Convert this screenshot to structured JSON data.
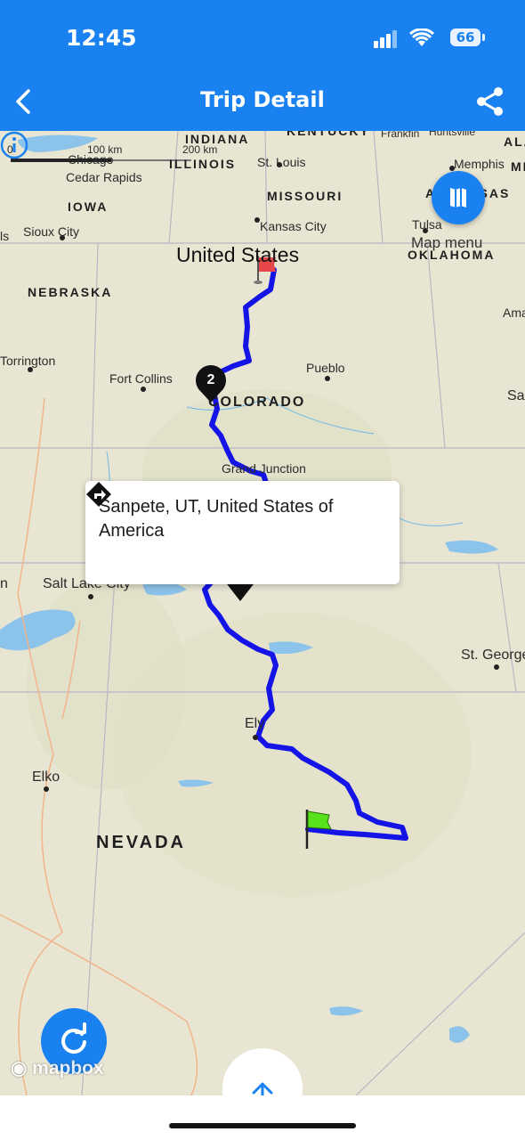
{
  "status_bar": {
    "time": "12:45",
    "battery": "66"
  },
  "header": {
    "title": "Trip Detail"
  },
  "map": {
    "scale": {
      "left": "0",
      "mid_top": "100 km",
      "mid_bottom": "200 km"
    },
    "country_label": "United States",
    "states": [
      "INDIANA",
      "ILLINOIS",
      "KENTUCKY",
      "MISSOURI",
      "IOWA",
      "NEBRASKA",
      "OKLAHOMA",
      "COLORADO",
      "NEVADA",
      "ALA",
      "MI",
      "ARKANSAS"
    ],
    "cities": [
      "Chicago",
      "Cedar Rapids",
      "Sioux City",
      "Kansas City",
      "St. Louis",
      "Memphis",
      "Tulsa",
      "Frankfin",
      "Huntsville",
      "Torrington",
      "Fort Collins",
      "Pueblo",
      "Grand Junction",
      "Salt Lake City",
      "St. George",
      "Ely",
      "Elko",
      "Ama",
      "Sa",
      "ls",
      "n"
    ],
    "map_menu_label": "Map menu",
    "cluster_count": "2",
    "attribution": "mapbox"
  },
  "popup": {
    "location": "Sanpete, UT, United States of America"
  },
  "colors": {
    "accent": "#1a82f0",
    "route": "#1414e6",
    "start_flag": "#e8474a",
    "end_flag": "#58e21b"
  }
}
